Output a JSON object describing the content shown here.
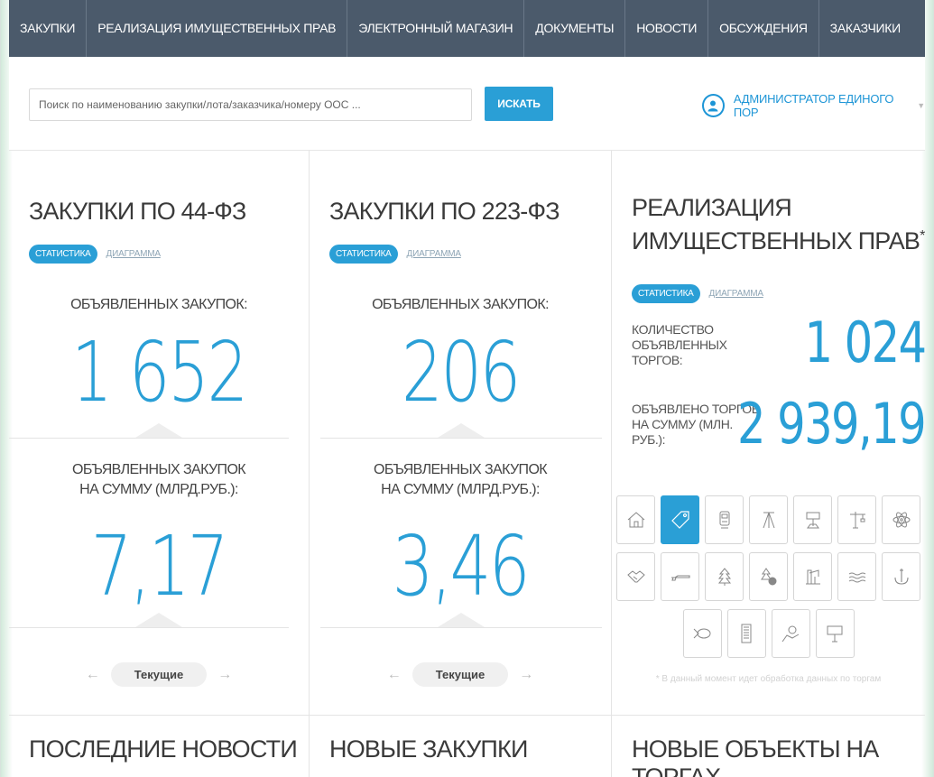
{
  "nav": {
    "items": [
      "ЗАКУПКИ",
      "РЕАЛИЗАЦИЯ ИМУЩЕСТВЕННЫХ ПРАВ",
      "ЭЛЕКТРОННЫЙ МАГАЗИН",
      "ДОКУМЕНТЫ",
      "НОВОСТИ",
      "ОБСУЖДЕНИЯ",
      "ЗАКАЗЧИКИ"
    ]
  },
  "search": {
    "placeholder": "Поиск по наименованию закупки/лота/заказчика/номеру ООС ...",
    "button": "ИСКАТЬ"
  },
  "user": {
    "name": "АДМИНИСТРАТОР ЕДИНОГО ПОР"
  },
  "panel44": {
    "title": "ЗАКУПКИ ПО 44-ФЗ",
    "tab_active": "СТАТИСТИКА",
    "tab_link": "ДИАГРАММА",
    "label1": "ОБЪЯВЛЕННЫХ ЗАКУПОК:",
    "value1": "1 652",
    "label2_line1": "ОБЪЯВЛЕННЫХ ЗАКУПОК",
    "label2_line2": "НА СУММУ (МЛРД.РУБ.):",
    "value2": "7,17",
    "pager": "Текущие"
  },
  "panel223": {
    "title": "ЗАКУПКИ ПО 223-ФЗ",
    "tab_active": "СТАТИСТИКА",
    "tab_link": "ДИАГРАММА",
    "label1": "ОБЪЯВЛЕННЫХ ЗАКУПОК:",
    "value1": "206",
    "label2_line1": "ОБЪЯВЛЕННЫХ ЗАКУПОК",
    "label2_line2": "НА СУММУ (МЛРД.РУБ.):",
    "value2": "3,46",
    "pager": "Текущие"
  },
  "panelRights": {
    "title_line1": "РЕАЛИЗАЦИЯ",
    "title_line2": "ИМУЩЕСТВЕННЫХ ПРАВ",
    "title_mark": "*",
    "tab_active": "СТАТИСТИКА",
    "tab_link": "ДИАГРАММА",
    "count_label_1": "КОЛИЧЕСТВО",
    "count_label_2": "ОБЪЯВЛЕННЫХ",
    "count_label_3": "ТОРГОВ:",
    "count_value": "1 024",
    "sum_label_1": "ОБЪЯВЛЕНО ТОРГОВ",
    "sum_label_2": "НА СУММУ (МЛН.",
    "sum_label_3": "РУБ.):",
    "sum_value": "2 939,19",
    "note": "* В данный момент идет обработка данных по торгам",
    "icons_row1": [
      "house-icon",
      "tag-icon",
      "train-icon",
      "tower-icon",
      "road-sign-icon",
      "crane-icon",
      "atom-icon"
    ],
    "icons_row2": [
      "handshake-icon",
      "rifle-icon",
      "tree-icon",
      "tree-coin-icon",
      "oil-pump-icon",
      "water-waves-icon",
      "anchor-icon"
    ],
    "icons_row3": [
      "fish-icon",
      "building-icon",
      "map-pin-icon",
      "billboard-icon"
    ],
    "active_icon": "tag-icon",
    "accent_color": "#2a9fd6"
  },
  "bottom": {
    "news": "ПОСЛЕДНИЕ НОВОСТИ",
    "new_purchases": "НОВЫЕ ЗАКУПКИ",
    "new_objects": "НОВЫЕ ОБЪЕКТЫ НА ТОРГАХ"
  }
}
